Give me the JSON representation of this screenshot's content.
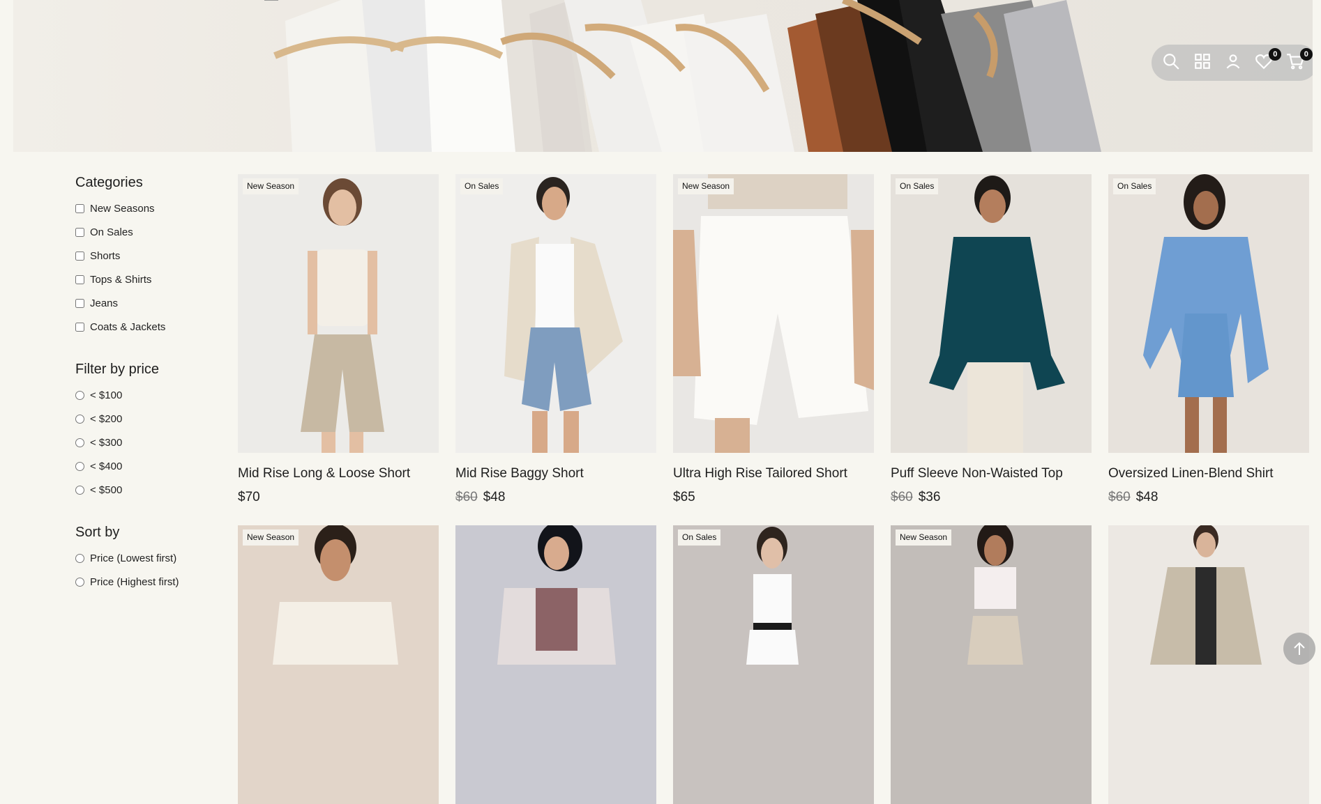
{
  "toolbar": {
    "icons": [
      "search-icon",
      "grid-icon",
      "user-icon",
      "heart-icon",
      "cart-icon"
    ],
    "wishlist_count": "0",
    "cart_count": "0"
  },
  "sidebar": {
    "categories": {
      "title": "Categories",
      "options": [
        "New Seasons",
        "On Sales",
        "Shorts",
        "Tops & Shirts",
        "Jeans",
        "Coats & Jackets"
      ]
    },
    "price_filter": {
      "title": "Filter by price",
      "options": [
        "< $100",
        "< $200",
        "< $300",
        "< $400",
        "< $500"
      ]
    },
    "sort": {
      "title": "Sort by",
      "options": [
        "Price (Lowest first)",
        "Price (Highest first)"
      ]
    }
  },
  "products": [
    {
      "tag": "New Season",
      "name": "Mid Rise Long & Loose Short",
      "old_price": "",
      "price": "$70"
    },
    {
      "tag": "On Sales",
      "name": "Mid Rise Baggy Short",
      "old_price": "$60",
      "price": "$48"
    },
    {
      "tag": "New Season",
      "name": "Ultra High Rise Tailored Short",
      "old_price": "",
      "price": "$65"
    },
    {
      "tag": "On Sales",
      "name": "Puff Sleeve Non-Waisted Top",
      "old_price": "$60",
      "price": "$36"
    },
    {
      "tag": "On Sales",
      "name": "Oversized Linen-Blend Shirt",
      "old_price": "$60",
      "price": "$48"
    },
    {
      "tag": "New Season",
      "name": "",
      "old_price": "",
      "price": ""
    },
    {
      "tag": "",
      "name": "",
      "old_price": "",
      "price": ""
    },
    {
      "tag": "On Sales",
      "name": "",
      "old_price": "",
      "price": ""
    },
    {
      "tag": "New Season",
      "name": "",
      "old_price": "",
      "price": ""
    },
    {
      "tag": "",
      "name": "",
      "old_price": "",
      "price": ""
    }
  ],
  "colors": {
    "page_bg": "#f7f6f0",
    "badge_bg": "#111111",
    "tag_bg": "#f4f2ec"
  }
}
